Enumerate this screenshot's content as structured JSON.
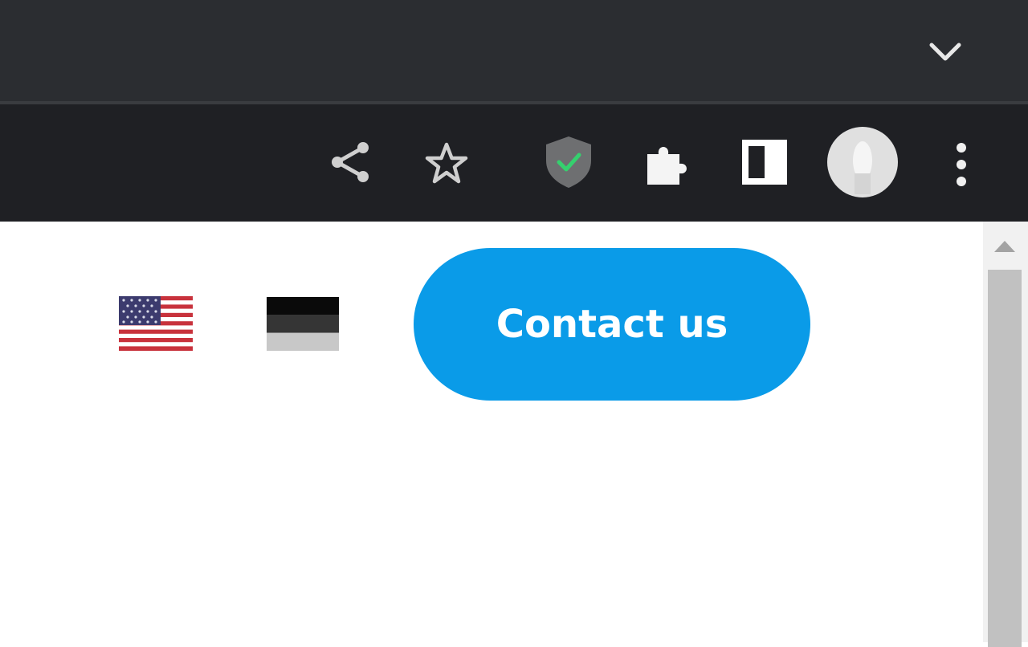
{
  "browser": {
    "icons": [
      "chevron-down-icon",
      "share-icon",
      "star-icon",
      "shield-check-icon",
      "puzzle-icon",
      "side-panel-icon",
      "avatar",
      "kebab-menu-icon"
    ],
    "colors": {
      "tabstrip": "#2b2d31",
      "toolbar": "#1f2024",
      "shield": "#6e6f71",
      "check": "#35d06e"
    }
  },
  "page": {
    "flags": [
      "us-flag-icon",
      "de-flag-icon"
    ],
    "contact_button": {
      "label": "Contact us",
      "color": "#0a9be8"
    }
  }
}
